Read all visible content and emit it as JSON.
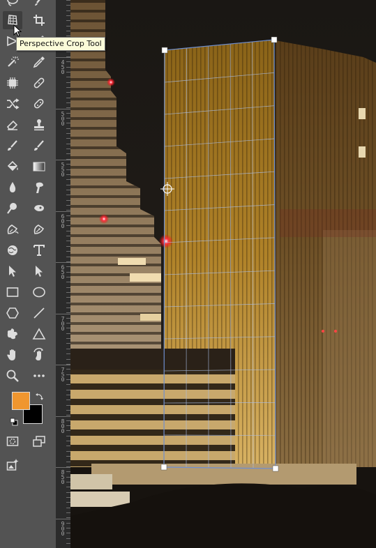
{
  "tooltip": {
    "text": "Perspective Crop Tool"
  },
  "toolbar": {
    "tools": [
      {
        "name": "lasso-tool-icon",
        "active": false
      },
      {
        "name": "brush-tool-icon",
        "active": false
      },
      {
        "name": "perspective-crop-tool-icon",
        "active": true
      },
      {
        "name": "crop-tool-icon",
        "active": false
      },
      {
        "name": "slice-tool-icon",
        "active": false
      },
      {
        "name": "eyedropper-tool-icon",
        "active": false
      },
      {
        "name": "spot-healing-brush-icon",
        "active": false
      },
      {
        "name": "color-sampler-icon",
        "active": false
      },
      {
        "name": "chip-icon",
        "active": false
      },
      {
        "name": "bandaid-icon",
        "active": false
      },
      {
        "name": "content-aware-move-icon",
        "active": false
      },
      {
        "name": "clone-stamp-icon",
        "active": false
      },
      {
        "name": "eraser-tool-icon",
        "active": false
      },
      {
        "name": "stamp-tool-icon",
        "active": false
      },
      {
        "name": "history-brush-icon",
        "active": false
      },
      {
        "name": "art-brush-icon",
        "active": false
      },
      {
        "name": "paint-bucket-icon",
        "active": false
      },
      {
        "name": "gradient-tool-icon",
        "active": false
      },
      {
        "name": "blur-tool-icon",
        "active": false
      },
      {
        "name": "smudge-tool-icon",
        "active": false
      },
      {
        "name": "dodge-tool-icon",
        "active": false
      },
      {
        "name": "burn-tool-icon",
        "active": false
      },
      {
        "name": "freeform-pen-icon",
        "active": false
      },
      {
        "name": "pen-tool-icon",
        "active": false
      },
      {
        "name": "content-aware-icon",
        "active": false
      },
      {
        "name": "type-tool-icon",
        "active": false
      },
      {
        "name": "path-selection-icon",
        "active": false
      },
      {
        "name": "direct-selection-icon",
        "active": false
      },
      {
        "name": "rectangle-tool-icon",
        "active": false
      },
      {
        "name": "ellipse-tool-icon",
        "active": false
      },
      {
        "name": "polygon-tool-icon",
        "active": false
      },
      {
        "name": "line-tool-icon",
        "active": false
      },
      {
        "name": "custom-shape-icon",
        "active": false
      },
      {
        "name": "triangle-tool-icon",
        "active": false
      },
      {
        "name": "hand-tool-icon",
        "active": false
      },
      {
        "name": "rotate-view-icon",
        "active": false
      },
      {
        "name": "zoom-tool-icon",
        "active": false
      },
      {
        "name": "more-tools-icon",
        "active": false
      },
      {
        "name": "quick-mask-icon",
        "active": false
      },
      {
        "name": "screen-mode-icon",
        "active": false
      },
      {
        "name": "generative-fill-icon",
        "active": false
      }
    ],
    "foreground_color": "#f0962f",
    "background_color": "#000000"
  },
  "ruler": {
    "labels": [
      "450",
      "500",
      "550",
      "600",
      "650",
      "700",
      "750",
      "800",
      "850",
      "900"
    ]
  }
}
